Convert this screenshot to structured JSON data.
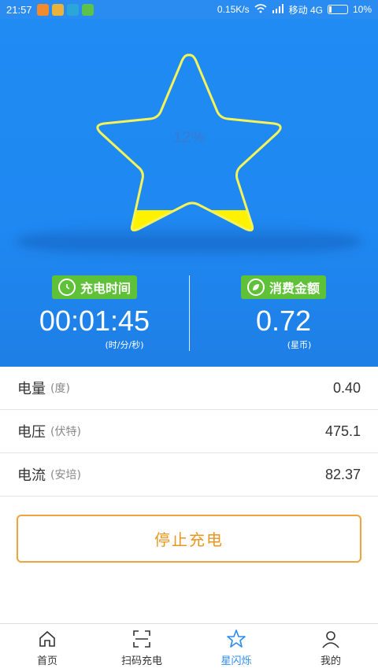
{
  "status_bar": {
    "time": "21:57",
    "speed": "0.15K/s",
    "carrier": "移动 4G",
    "battery": "10%"
  },
  "star": {
    "percent_label": "12%",
    "fill_fraction": 0.12,
    "outline_color": "#f6f35a",
    "fill_color": "#fff200"
  },
  "charge_time": {
    "label": "充电时间",
    "value": "00:01:45",
    "unit": "(时/分/秒)",
    "icon": "clock-icon"
  },
  "cost": {
    "label": "消费金额",
    "value": "0.72",
    "unit": "(星币)",
    "icon": "leaf-icon"
  },
  "rows": [
    {
      "label": "电量",
      "sub": "(度)",
      "value": "0.40"
    },
    {
      "label": "电压",
      "sub": "(伏特)",
      "value": "475.1"
    },
    {
      "label": "电流",
      "sub": "(安培)",
      "value": "82.37"
    }
  ],
  "stop_button": {
    "label": "停止充电"
  },
  "nav": [
    {
      "label": "首页",
      "icon": "home-icon"
    },
    {
      "label": "扫码充电",
      "icon": "scan-icon"
    },
    {
      "label": "星闪烁",
      "icon": "star-icon",
      "active": true
    },
    {
      "label": "我的",
      "icon": "user-icon"
    }
  ],
  "colors": {
    "hero_blue": "#1f8bf3",
    "badge_green": "#5fc137",
    "accent_orange": "#f0a23c",
    "active_blue": "#2a8bf0"
  }
}
